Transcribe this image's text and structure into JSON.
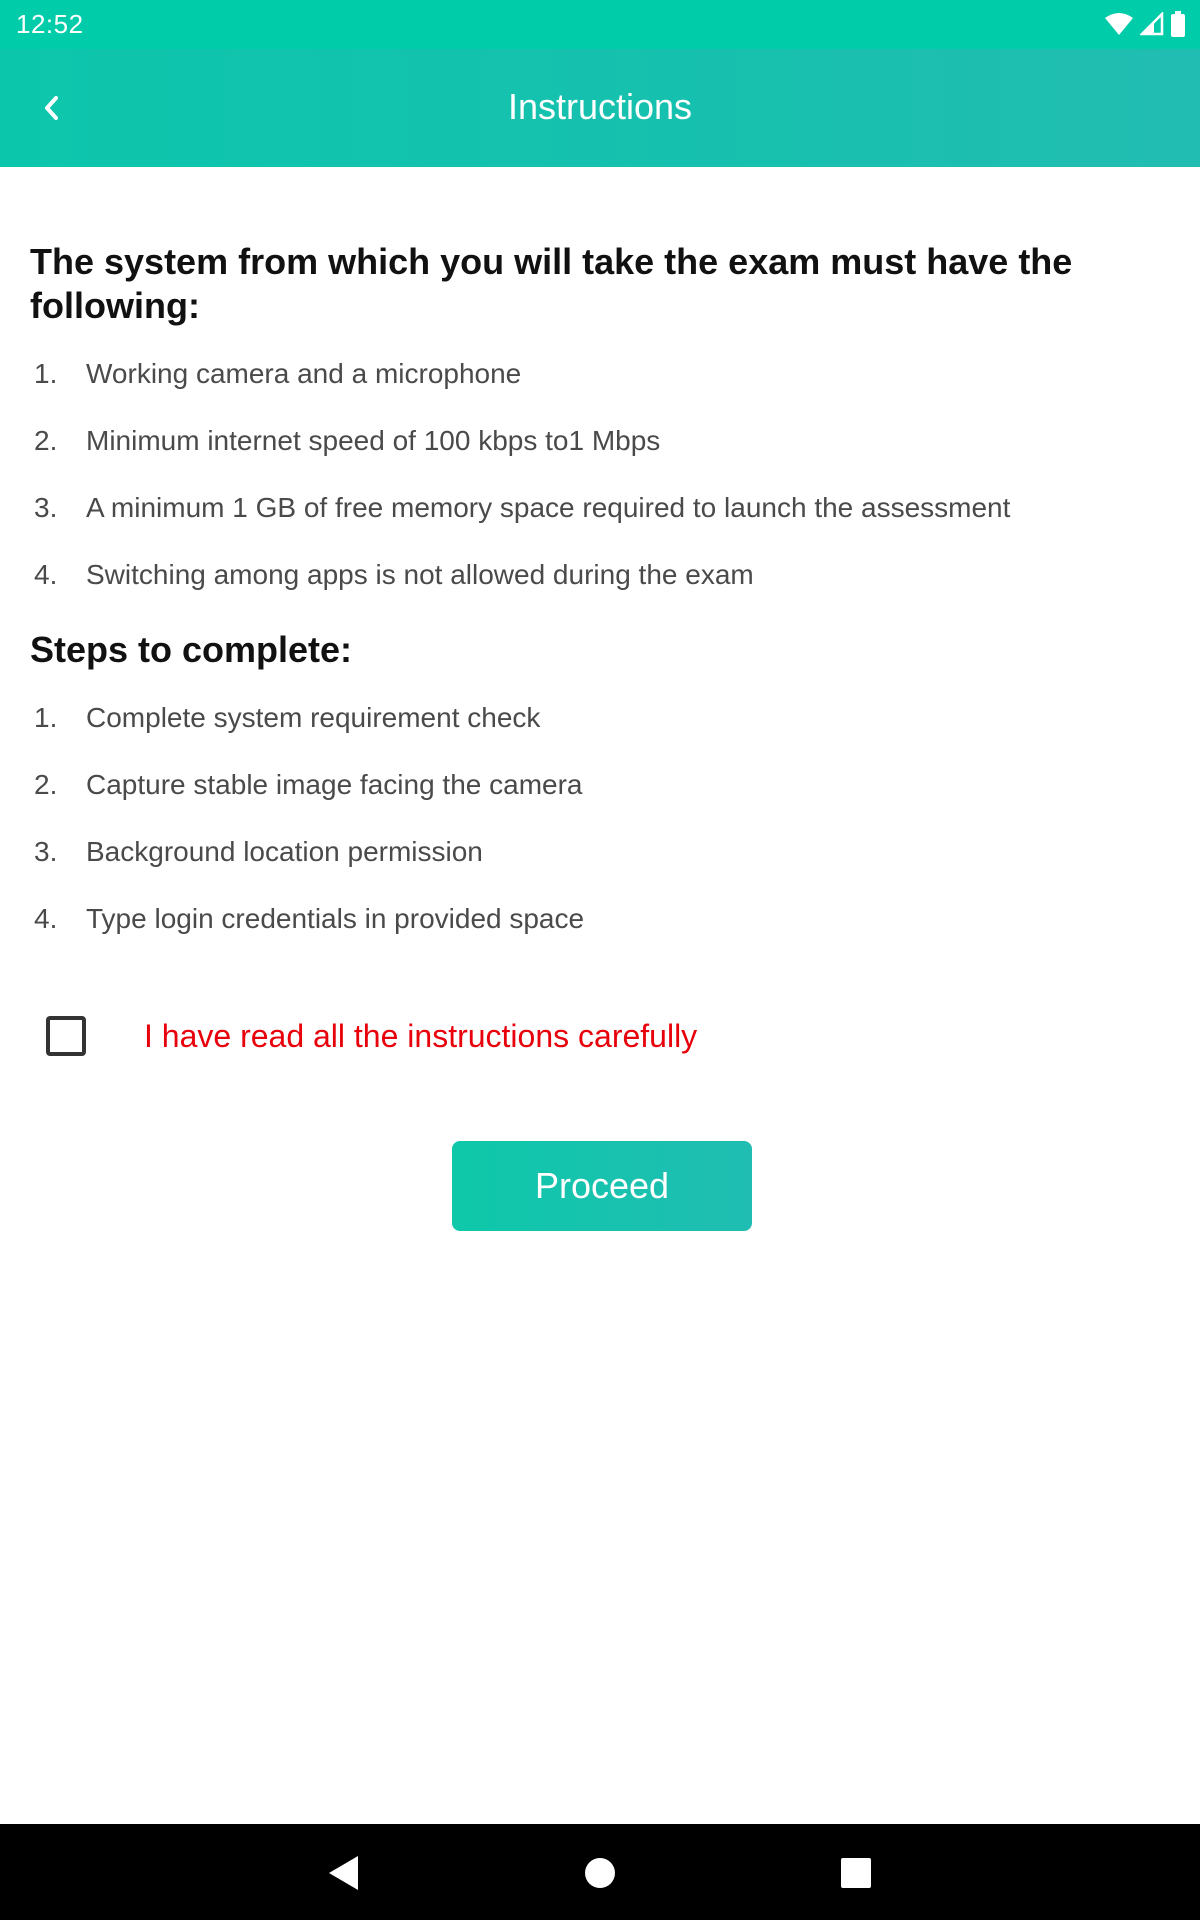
{
  "status_bar": {
    "time": "12:52",
    "icons": [
      "wifi-icon",
      "cell-signal-icon",
      "battery-icon"
    ]
  },
  "toolbar": {
    "title": "Instructions",
    "back_icon": "chevron-left-icon"
  },
  "requirements": {
    "heading": "The system from which you will take the exam must have the following:",
    "items": [
      {
        "num": "1.",
        "text": "Working camera and a microphone"
      },
      {
        "num": "2.",
        "text": "Minimum internet speed of 100 kbps to1 Mbps"
      },
      {
        "num": "3.",
        "text": "A minimum 1 GB of free memory space required to launch the assessment"
      },
      {
        "num": "4.",
        "text": "Switching among apps is not allowed during the exam"
      }
    ]
  },
  "steps": {
    "heading": "Steps to complete:",
    "items": [
      {
        "num": "1.",
        "text": "Complete system requirement check"
      },
      {
        "num": "2.",
        "text": "Capture stable image facing the camera"
      },
      {
        "num": "3.",
        "text": "Background location permission"
      },
      {
        "num": "4.",
        "text": "Type login credentials in provided space"
      }
    ]
  },
  "agreement": {
    "label": "I have read all the instructions carefully",
    "checked": false
  },
  "proceed": {
    "label": "Proceed"
  },
  "nav_bar": {
    "icons": [
      "nav-back-icon",
      "nav-home-icon",
      "nav-recents-icon"
    ]
  },
  "colors": {
    "accent": "#1ABFAE",
    "status_bar": "#00CCAA",
    "warning_text": "#E8000B"
  }
}
